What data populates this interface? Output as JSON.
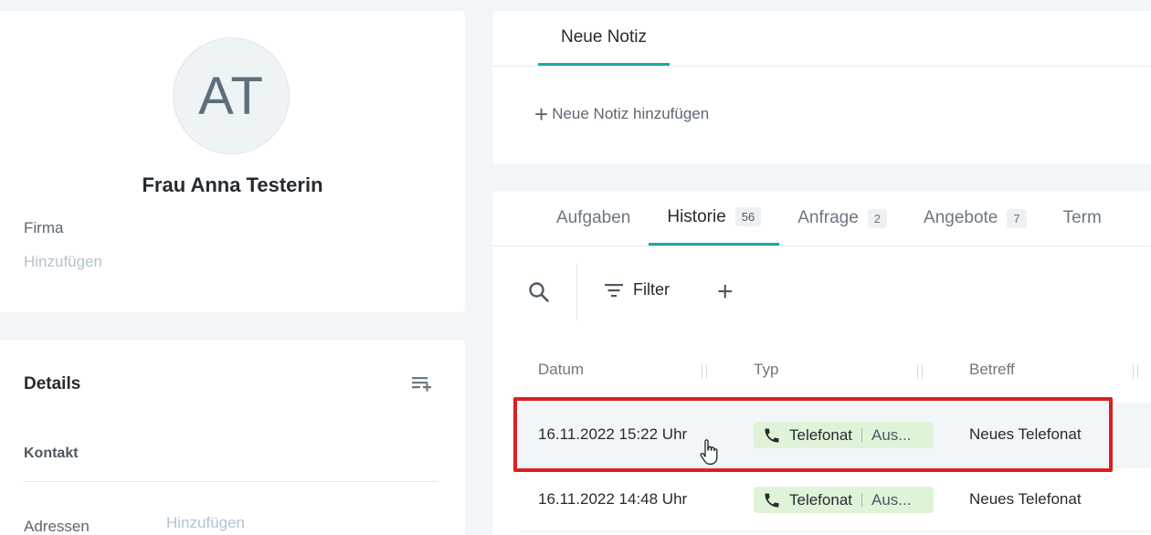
{
  "profile": {
    "initials": "AT",
    "name": "Frau Anna Testerin",
    "firma_label": "Firma",
    "firma_add": "Hinzufügen"
  },
  "details": {
    "title": "Details",
    "kontakt": "Kontakt",
    "adressen_label": "Adressen",
    "adressen_add": "Hinzufügen",
    "icon": "add-list-icon"
  },
  "note": {
    "tab_label": "Neue Notiz",
    "add_label": "Neue Notiz hinzufügen"
  },
  "history": {
    "tabs": [
      {
        "label": "Aufgaben",
        "count": null
      },
      {
        "label": "Historie",
        "count": "56"
      },
      {
        "label": "Anfrage",
        "count": "2"
      },
      {
        "label": "Angebote",
        "count": "7"
      },
      {
        "label": "Term",
        "count": null
      }
    ],
    "toolbar": {
      "filter_label": "Filter"
    },
    "columns": {
      "date": "Datum",
      "type": "Typ",
      "subject": "Betreff"
    },
    "rows": [
      {
        "date": "16.11.2022 15:22 Uhr",
        "type": "Telefonat",
        "status": "Aus...",
        "subject": "Neues Telefonat"
      },
      {
        "date": "16.11.2022 14:48 Uhr",
        "type": "Telefonat",
        "status": "Aus...",
        "subject": "Neues Telefonat"
      }
    ]
  },
  "colors": {
    "accent": "#1aa7a0",
    "chip_bg": "#dff3d9",
    "highlight_box": "#dc1f1f"
  }
}
